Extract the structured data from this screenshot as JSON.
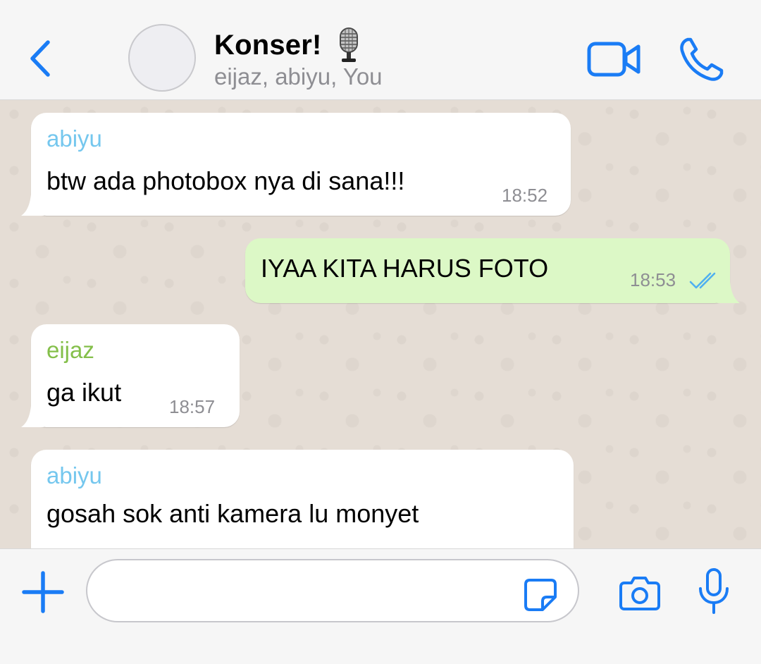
{
  "header": {
    "title": "Konser!",
    "subtitle": "eijaz, abiyu, You",
    "title_emoji": "studio-microphone-emoji"
  },
  "colors": {
    "accent": "#1a7cf5",
    "sender_abiyu": "#75c7ee",
    "sender_eijaz": "#84bf4a",
    "outgoing_bubble": "#dcf8c6",
    "incoming_bubble": "#ffffff",
    "read_receipt": "#4fb0f0"
  },
  "messages": [
    {
      "direction": "in",
      "sender": "abiyu",
      "text": "btw ada photobox nya di sana!!!",
      "time": "18:52"
    },
    {
      "direction": "out",
      "text": "IYAA KITA HARUS FOTO",
      "time": "18:53",
      "status": "read"
    },
    {
      "direction": "in",
      "sender": "eijaz",
      "text": "ga ikut",
      "time": "18:57"
    },
    {
      "direction": "in",
      "sender": "abiyu",
      "text": "gosah sok anti kamera lu monyet",
      "time": ""
    }
  ],
  "composer": {
    "input_value": "",
    "icons": [
      "plus-icon",
      "sticker-icon",
      "camera-icon",
      "microphone-icon"
    ]
  },
  "header_icons": [
    "back-chevron-icon",
    "video-call-icon",
    "phone-call-icon"
  ]
}
